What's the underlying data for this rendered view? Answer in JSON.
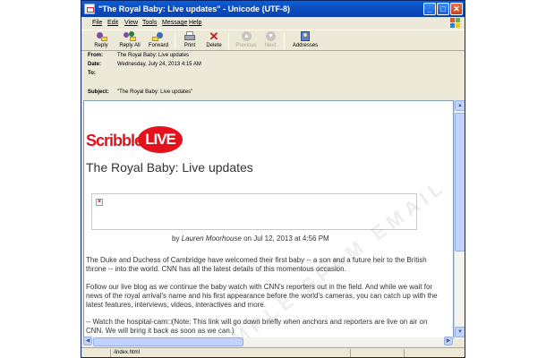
{
  "window": {
    "title": "\"The Royal Baby: Live updates\"  - Unicode (UTF-8)"
  },
  "menu": [
    {
      "label": "File"
    },
    {
      "label": "Edit"
    },
    {
      "label": "View"
    },
    {
      "label": "Tools"
    },
    {
      "label": "Message"
    },
    {
      "label": "Help"
    }
  ],
  "toolbar": {
    "reply": "Reply",
    "reply_all": "Reply All",
    "forward": "Forward",
    "print": "Print",
    "delete": "Delete",
    "previous": "Previous",
    "next": "Next",
    "addresses": "Addresses"
  },
  "headers": {
    "from_label": "From:",
    "from_value": "The Royal Baby: Live updates",
    "date_label": "Date:",
    "date_value": "Wednesday, July 24, 2013 4:15 AM",
    "to_label": "To:",
    "to_value": "",
    "subject_label": "Subject:",
    "subject_value": "\"The Royal Baby: Live updates\""
  },
  "email": {
    "logo_scribble": "Scribble",
    "logo_live": "LIVE",
    "title": "The Royal Baby: Live updates",
    "by": "by",
    "author": "Lauren Moorhouse",
    "date_text": "on Jul 12, 2013 at 4:56 PM",
    "paragraph1": "The Duke and Duchess of Cambridge have welcomed their first baby -- a son and a future heir to the British throne -- into the world. CNN has all the latest details of this momentous occasion.",
    "paragraph2": "Follow our live blog as we continue the baby watch with CNN's reporters out in the field. And while we wait for news of the royal arrival's name and his first appearance before the world's cameras, you can catch up with the latest features, interviews, videos, interactives and more.",
    "paragraph3": "-- Watch the hospital-cam□(Note: This link will go down briefly when anchors and reporters are live on air on CNN. We will bring it back as soon as we can.)",
    "watermark": "SAMPLE SPAM EMAIL"
  },
  "status": {
    "text": "/index.html"
  },
  "colors": {
    "brand_red": "#e4121a",
    "titlebar_blue": "#0b4fc1"
  }
}
